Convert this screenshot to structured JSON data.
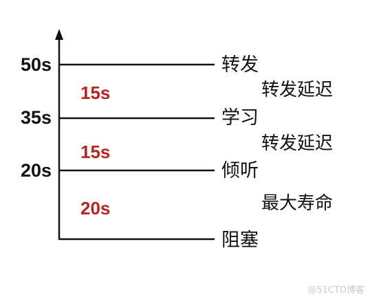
{
  "diagram": {
    "ticks": [
      "50s",
      "35s",
      "20s"
    ],
    "durations": [
      "15s",
      "15s",
      "20s"
    ],
    "states": [
      "转发",
      "学习",
      "倾听",
      "阻塞"
    ],
    "notes": [
      "转发延迟",
      "转发延迟",
      "最大寿命"
    ]
  },
  "watermark": "@51CTO博客",
  "colors": {
    "axis": "#111111",
    "duration_text": "#b8241e",
    "text": "#111111"
  }
}
